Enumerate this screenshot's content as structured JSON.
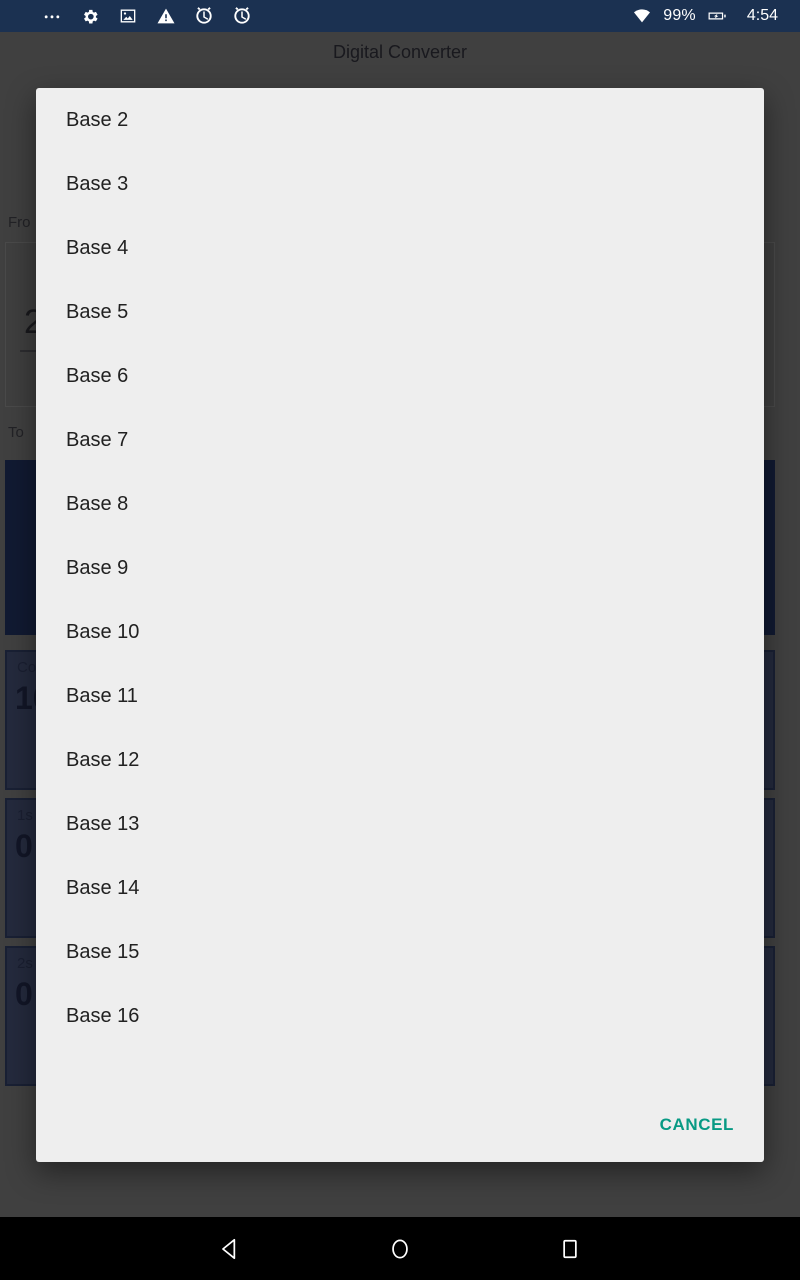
{
  "status_bar": {
    "background_color": "#1b3151",
    "left_icons": [
      {
        "name": "overflow-dots-icon",
        "label": "more notifications"
      },
      {
        "name": "gear-icon",
        "label": "settings"
      },
      {
        "name": "image-icon",
        "label": "screenshot"
      },
      {
        "name": "warning-icon",
        "label": "warning"
      },
      {
        "name": "alarm-icon-1",
        "label": "alarm"
      },
      {
        "name": "alarm-icon-2",
        "label": "alarm"
      }
    ],
    "wifi_icon": "wifi-icon",
    "battery_percent": "99%",
    "battery_icon": "battery-charging-icon",
    "clock": "4:54"
  },
  "app": {
    "title": "Digital Converter",
    "tabs": [
      {
        "label": "",
        "active": false
      },
      {
        "label": "",
        "active": false
      },
      {
        "label": "",
        "active": true
      }
    ],
    "from_label": "Fro",
    "to_label": "To ",
    "input_value": "2",
    "accent_navy": "#1d2c54",
    "cards": [
      {
        "label": "Co",
        "value": "10"
      },
      {
        "label": "1s",
        "value": "0"
      },
      {
        "label": "2s",
        "value": "0"
      }
    ]
  },
  "dialog": {
    "background_color": "#eeeeee",
    "options": [
      {
        "label": "Base 2"
      },
      {
        "label": "Base 3"
      },
      {
        "label": "Base 4"
      },
      {
        "label": "Base 5"
      },
      {
        "label": "Base 6"
      },
      {
        "label": "Base 7"
      },
      {
        "label": "Base 8"
      },
      {
        "label": "Base 9"
      },
      {
        "label": "Base 10"
      },
      {
        "label": "Base 11"
      },
      {
        "label": "Base 12"
      },
      {
        "label": "Base 13"
      },
      {
        "label": "Base 14"
      },
      {
        "label": "Base 15"
      },
      {
        "label": "Base 16"
      }
    ],
    "cancel_label": "CANCEL",
    "cancel_color": "#089a84"
  },
  "navigation_bar": {
    "background_color": "#000000",
    "buttons": [
      {
        "name": "back-button",
        "icon": "back-triangle-icon"
      },
      {
        "name": "home-button",
        "icon": "home-circle-icon"
      },
      {
        "name": "recents-button",
        "icon": "recents-square-icon"
      }
    ]
  }
}
